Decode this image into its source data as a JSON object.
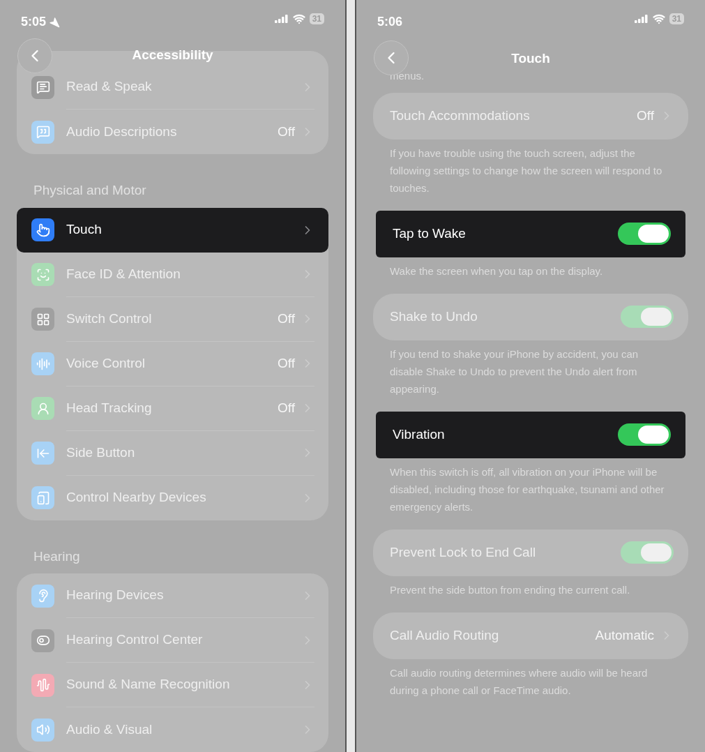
{
  "left": {
    "status": {
      "time": "5:05",
      "battery": "31"
    },
    "nav": {
      "title": "Accessibility"
    },
    "groups": [
      {
        "rows": [
          {
            "label": "Read & Speak",
            "highlighted": false
          },
          {
            "label": "Audio Descriptions",
            "value": "Off",
            "highlighted": false
          }
        ]
      },
      {
        "header": "Physical and Motor",
        "rows": [
          {
            "label": "Touch",
            "highlighted": true
          },
          {
            "label": "Face ID & Attention",
            "highlighted": false
          },
          {
            "label": "Switch Control",
            "value": "Off",
            "highlighted": false
          },
          {
            "label": "Voice Control",
            "value": "Off",
            "highlighted": false
          },
          {
            "label": "Head Tracking",
            "value": "Off",
            "highlighted": false
          },
          {
            "label": "Side Button",
            "highlighted": false
          },
          {
            "label": "Control Nearby Devices",
            "highlighted": false
          }
        ]
      },
      {
        "header": "Hearing",
        "rows": [
          {
            "label": "Hearing Devices",
            "highlighted": false
          },
          {
            "label": "Hearing Control Center",
            "highlighted": false
          },
          {
            "label": "Sound & Name Recognition",
            "highlighted": false
          },
          {
            "label": "Audio & Visual",
            "highlighted": false
          }
        ]
      }
    ]
  },
  "right": {
    "status": {
      "time": "5:06",
      "battery": "31"
    },
    "nav": {
      "title": "Touch"
    },
    "intro": "menus.",
    "items": [
      {
        "kind": "link",
        "label": "Touch Accommodations",
        "value": "Off",
        "highlighted": false,
        "footer": "If you have trouble using the touch screen, adjust the following settings to change how the screen will respond to touches."
      },
      {
        "kind": "toggle",
        "label": "Tap to Wake",
        "on": true,
        "highlighted": true,
        "footer": "Wake the screen when you tap on the display."
      },
      {
        "kind": "toggle",
        "label": "Shake to Undo",
        "on": true,
        "highlighted": false,
        "footer": "If you tend to shake your iPhone by accident, you can disable Shake to Undo to prevent the Undo alert from appearing."
      },
      {
        "kind": "toggle",
        "label": "Vibration",
        "on": true,
        "highlighted": true,
        "footer": "When this switch is off, all vibration on your iPhone will be disabled, including those for earthquake, tsunami and other emergency alerts."
      },
      {
        "kind": "toggle",
        "label": "Prevent Lock to End Call",
        "on": true,
        "highlighted": false,
        "footer": "Prevent the side button from ending the current call."
      },
      {
        "kind": "link",
        "label": "Call Audio Routing",
        "value": "Automatic",
        "highlighted": false,
        "footer": "Call audio routing determines where audio will be heard during a phone call or FaceTime audio."
      }
    ]
  }
}
